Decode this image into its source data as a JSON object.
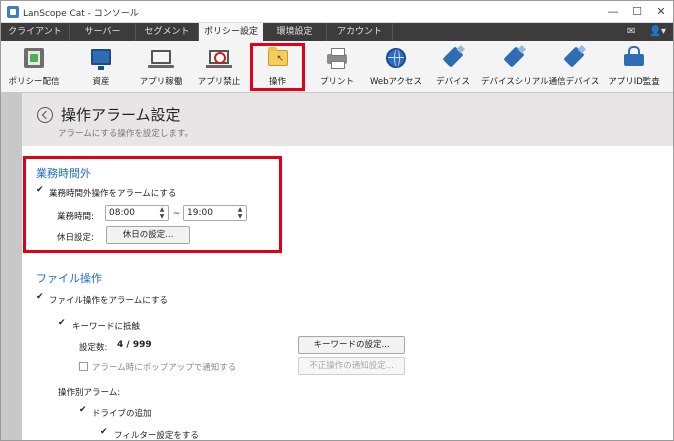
{
  "window": {
    "title": "LanScope Cat - コンソール",
    "min_icon": "minimize-icon",
    "max_icon": "maximize-icon",
    "close_icon": "close-icon",
    "min_glyph": "—",
    "max_glyph": "☐",
    "close_glyph": "✕"
  },
  "tabs": [
    {
      "label": "クライアント",
      "active": false
    },
    {
      "label": "サーバー",
      "active": false
    },
    {
      "label": "セグメント",
      "active": false
    },
    {
      "label": "ポリシー設定",
      "active": true
    },
    {
      "label": "環境設定",
      "active": false
    },
    {
      "label": "アカウント",
      "active": false
    }
  ],
  "tab_icons": {
    "message_glyph": "✉",
    "user_glyph": "👤",
    "dropdown_glyph": "▾"
  },
  "toolbar": [
    {
      "label": "ポリシー配信",
      "icon": "policy-distribution-icon"
    },
    {
      "label": "資産",
      "icon": "monitor-icon"
    },
    {
      "label": "アプリ稼働",
      "icon": "laptop-icon"
    },
    {
      "label": "アプリ禁止",
      "icon": "ban-icon"
    },
    {
      "label": "操作",
      "icon": "folder-cursor-icon",
      "selected": true
    },
    {
      "label": "プリント",
      "icon": "printer-icon"
    },
    {
      "label": "Webアクセス",
      "icon": "globe-icon"
    },
    {
      "label": "デバイス",
      "icon": "usb-icon"
    },
    {
      "label": "デバイスシリアル",
      "icon": "usb-serial-icon"
    },
    {
      "label": "通信デバイス",
      "icon": "comm-device-icon"
    },
    {
      "label": "アプリID監査",
      "icon": "lock-icon"
    }
  ],
  "header": {
    "title": "操作アラーム設定",
    "subtitle": "アラームにする操作を設定します。"
  },
  "business_hours": {
    "section_title": "業務時間外",
    "alarm_checkbox_label": "業務時間外操作をアラームにする",
    "alarm_checked": true,
    "hours_label": "業務時間:",
    "start_time": "08:00",
    "separator": "~",
    "end_time": "19:00",
    "holiday_label": "休日設定:",
    "holiday_button": "休日の設定..."
  },
  "file_ops": {
    "section_title": "ファイル操作",
    "alarm_checkbox_label": "ファイル操作をアラームにする",
    "alarm_checked": true,
    "keyword_checkbox_label": "キーワードに抵触",
    "keyword_checked": true,
    "count_label": "設定数:",
    "count_value": "4 / 999",
    "keyword_button": "キーワードの設定...",
    "popup_checkbox_label": "アラーム時にポップアップで通知する",
    "popup_checked": false,
    "popup_button": "不正操作の通知設定...",
    "per_op_label": "操作別アラーム:",
    "drive_add_label": "ドライブの追加",
    "drive_add_checked": true,
    "filter_label": "フィルター設定をする",
    "filter_checked": true
  }
}
